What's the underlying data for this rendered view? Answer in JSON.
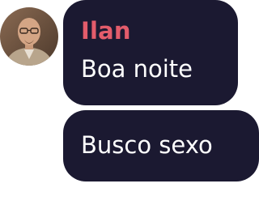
{
  "chat": {
    "messages": [
      {
        "sender": "Ilan",
        "text": "Boa noite"
      },
      {
        "text": "Busco sexo"
      }
    ]
  },
  "colors": {
    "bubble_bg": "#1b1931",
    "sender_name": "#e35c6b",
    "message_text": "#ffffff"
  }
}
